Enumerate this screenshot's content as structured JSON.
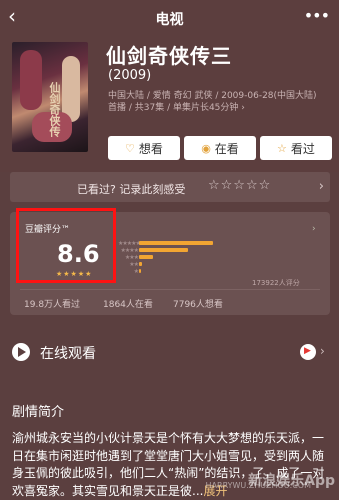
{
  "nav": {
    "back": "‹",
    "title": "电视",
    "more": "•••"
  },
  "poster": {
    "text": "仙剑奇侠传"
  },
  "show": {
    "title": "仙剑奇侠传三",
    "year": "(2009)",
    "meta_line1": "中国大陆 / 爱情 奇幻 武侠 / 2009-06-28(中国大陆)",
    "meta_line2": "首播 / 共37集 / 单集片长45分钟 ›"
  },
  "buttons": {
    "want": "想看",
    "watching": "在看",
    "watched": "看过",
    "want_icon": "♡",
    "watching_icon": "◉",
    "watched_icon": "☆"
  },
  "seen_bar": {
    "text": "已看过? 记录此刻感受",
    "stars": "☆☆☆☆☆",
    "chevron": "›"
  },
  "rating": {
    "label": "豆瓣评分™",
    "score": "8.6",
    "mini_stars": "★★★★★",
    "distribution": [
      {
        "stars": "★★★★★",
        "fraction": 0.53
      },
      {
        "stars": "★★★★",
        "fraction": 0.35
      },
      {
        "stars": "★★★",
        "fraction": 0.1
      },
      {
        "stars": "★★",
        "fraction": 0.02
      },
      {
        "stars": "★",
        "fraction": 0.01
      }
    ],
    "votes": "173922人评分",
    "chevron": "›"
  },
  "counts": {
    "watched": "19.8万人看过",
    "watching": "1864人在看",
    "want": "7796人想看"
  },
  "online": {
    "label": "在线观看",
    "chevron": "›"
  },
  "synopsis": {
    "title": "剧情简介",
    "text": "渝州城永安当的小伙计景天是个怀有大大梦想的乐天派，一日在集市闲逛时他遇到了堂堂唐门大小姐雪见，受到两人随身玉佩的彼此吸引，他们二人“热闹”的结识，了，成了一对欢喜冤家。其实雪见和景天正是彼...",
    "expand": "展开"
  },
  "watermark": {
    "app": "新浪娱乐App",
    "domain": "HARRYWU.ZHUZHOU.COM"
  },
  "colors": {
    "accent": "#f2a532",
    "bg": "#5b3f3f",
    "highlight": "#ff1212"
  }
}
